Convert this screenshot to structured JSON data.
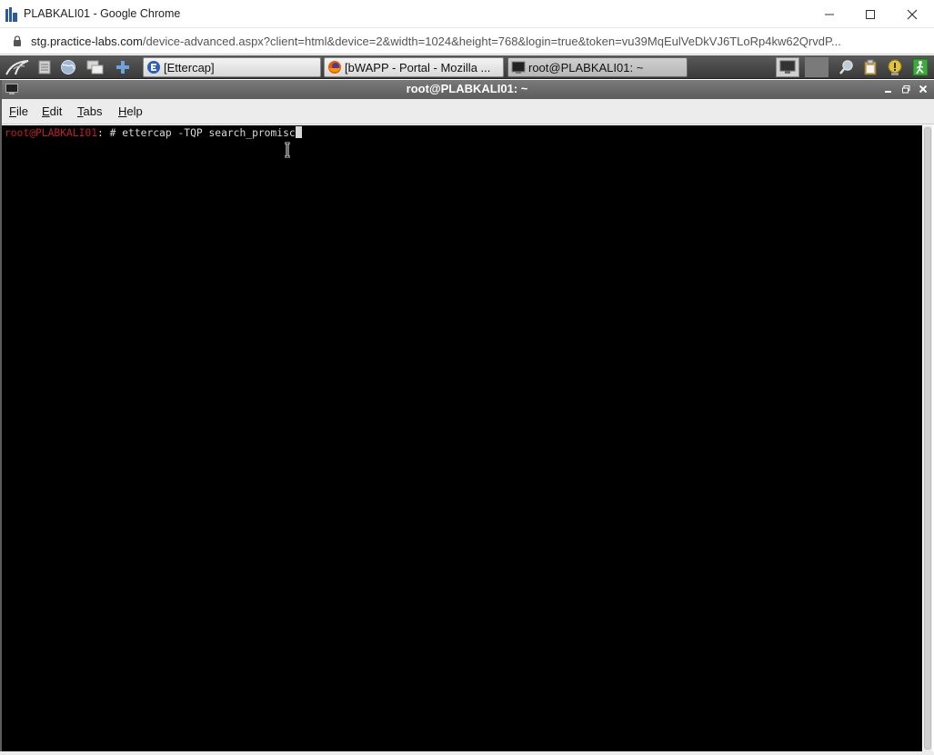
{
  "browser": {
    "window_title": "PLABKALI01 - Google Chrome",
    "url_host": "stg.practice-labs.com",
    "url_rest": "/device-advanced.aspx?client=html&device=2&width=1024&height=768&login=true&token=vu39MqEulVeDkVJ6TLoRp4kw62QrvdP...",
    "controls": [
      "minimize",
      "maximize",
      "close"
    ]
  },
  "taskbar": {
    "launchers": [
      "kali-menu-icon",
      "files-icon",
      "browser-icon",
      "windows-icon",
      "add-icon"
    ],
    "tasks": [
      {
        "label": "[Ettercap]",
        "icon": "ettercap-icon",
        "active": false
      },
      {
        "label": "[bWAPP - Portal - Mozilla ...",
        "icon": "firefox-icon",
        "active": false
      },
      {
        "label": "root@PLABKALI01: ~",
        "icon": "terminal-icon",
        "active": true
      }
    ],
    "tray": [
      "monitor-icon",
      "blank-icon",
      "search-icon",
      "clipboard-icon",
      "notification-icon",
      "logout-icon"
    ]
  },
  "terminal_window": {
    "title": "root@PLABKALI01: ~",
    "menus": [
      {
        "access": "F",
        "rest": "ile"
      },
      {
        "access": "E",
        "rest": "dit"
      },
      {
        "access": "T",
        "rest": "abs"
      },
      {
        "access": "H",
        "rest": "elp"
      }
    ],
    "prompt_user": "root@PLABKALI01",
    "prompt_rest": ": # ",
    "command": "ettercap -TQP search_promisc"
  },
  "colors": {
    "prompt_user": "#b8202b",
    "terminal_bg": "#000000",
    "terminal_fg": "#d8d8d8"
  }
}
